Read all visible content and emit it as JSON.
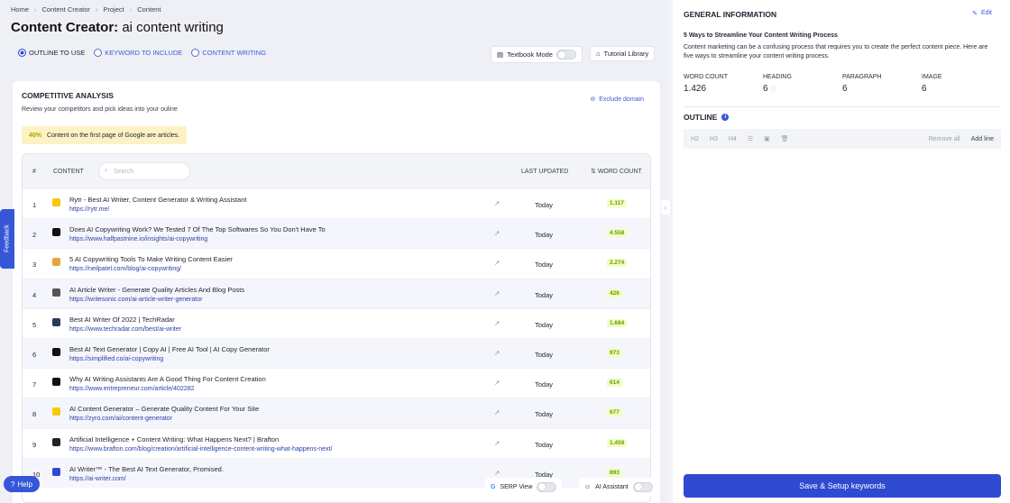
{
  "breadcrumb": [
    "Home",
    "Content Creator",
    "Project",
    "Content"
  ],
  "page_title": {
    "main": "Content Creator:",
    "sub": "ai content writing"
  },
  "steps": [
    {
      "label": "OUTLINE TO USE",
      "active": true
    },
    {
      "label": "KEYWORD TO INCLUDE",
      "active": false
    },
    {
      "label": "CONTENT WRITING",
      "active": false
    }
  ],
  "toolbar": {
    "textbook_mode": "Textbook Mode",
    "tutorial_library": "Tutorial Library"
  },
  "competitive": {
    "title": "COMPETITIVE ANALYSIS",
    "desc": "Review your competitors and pick ideas into your ouline",
    "exclude_domain": "Exclude domain",
    "notice_pct": "40%",
    "notice_text": "Content on the first page of Google are articles."
  },
  "table": {
    "headers": {
      "hash": "#",
      "content": "CONTENT",
      "search_placeholder": "Search",
      "last_updated": "LAST UPDATED",
      "word_count": "WORD COUNT"
    },
    "rows": [
      {
        "num": "1",
        "title": "Rytr - Best AI Writer, Content Generator & Writing Assistant",
        "url": "https://rytr.me/",
        "updated": "Today",
        "wc": "1.117",
        "fav": "#f6c90e"
      },
      {
        "num": "2",
        "title": "Does AI Copywriting Work? We Tested 7 Of The Top Softwares So You Don't Have To",
        "url": "https://www.halfpastnine.io/insights/ai-copywriting",
        "updated": "Today",
        "wc": "4.558",
        "fav": "#111111"
      },
      {
        "num": "3",
        "title": "5 AI Copywriting Tools To Make Writing Content Easier",
        "url": "https://neilpatel.com/blog/ai-copywriting/",
        "updated": "Today",
        "wc": "2.274",
        "fav": "#e8a33c"
      },
      {
        "num": "4",
        "title": "AI Article Writer - Generate Quality Articles And Blog Posts",
        "url": "https://writesonic.com/ai-article-writer-generator",
        "updated": "Today",
        "wc": "426",
        "fav": "#555555"
      },
      {
        "num": "5",
        "title": "Best AI Writer Of 2022 | TechRadar",
        "url": "https://www.techradar.com/best/ai-writer",
        "updated": "Today",
        "wc": "1.684",
        "fav": "#2b3a55"
      },
      {
        "num": "6",
        "title": "Best AI Text Generator | Copy AI | Free AI Tool | AI Copy Generator",
        "url": "https://simplified.co/ai-copywriting",
        "updated": "Today",
        "wc": "973",
        "fav": "#111111"
      },
      {
        "num": "7",
        "title": "Why AI Writing Assistants Are A Good Thing For Content Creation",
        "url": "https://www.entrepreneur.com/article/402282",
        "updated": "Today",
        "wc": "614",
        "fav": "#111111"
      },
      {
        "num": "8",
        "title": "AI Content Generator – Generate Quality Content For Your Site",
        "url": "https://zyro.com/ai/content-generator",
        "updated": "Today",
        "wc": "677",
        "fav": "#f6c90e"
      },
      {
        "num": "9",
        "title": "Artificial Intelligence + Content Writing: What Happens Next? | Brafton",
        "url": "https://www.brafton.com/blog/creation/artificial-intelligence-content-writing-what-happens-next/",
        "updated": "Today",
        "wc": "1.459",
        "fav": "#222222"
      },
      {
        "num": "10",
        "title": "AI Writer™ - The Best AI Text Generator, Promised.",
        "url": "https://ai-writer.com/",
        "updated": "Today",
        "wc": "893",
        "fav": "#2f4ad0"
      }
    ]
  },
  "feedback": "Feedback",
  "help": "Help",
  "bottom": {
    "serp_view": "SERP View",
    "ai_assistant": "AI Assistant"
  },
  "general": {
    "header": "GENERAL INFORMATION",
    "edit": "Edit",
    "article_title": "5 Ways to Streamline Your Content Writing Process",
    "article_desc": "Content marketing can be a confusing process that requires you to create the perfect content piece. Here are five ways to streamline your content writing process.",
    "stats": [
      {
        "label": "WORD COUNT",
        "value": "1.426"
      },
      {
        "label": "HEADING",
        "value": "6"
      },
      {
        "label": "PARAGRAPH",
        "value": "6"
      },
      {
        "label": "IMAGE",
        "value": "6"
      }
    ]
  },
  "outline": {
    "title": "OUTLINE",
    "tools": [
      "H2",
      "H3",
      "H4"
    ],
    "remove_all": "Remove all",
    "add_line": "Add line"
  },
  "save_button": "Save & Setup keywords",
  "colors": {
    "accent": "#2f4ad0",
    "wc_green": "#5ea100",
    "notice_bg": "#fdf2c4"
  }
}
